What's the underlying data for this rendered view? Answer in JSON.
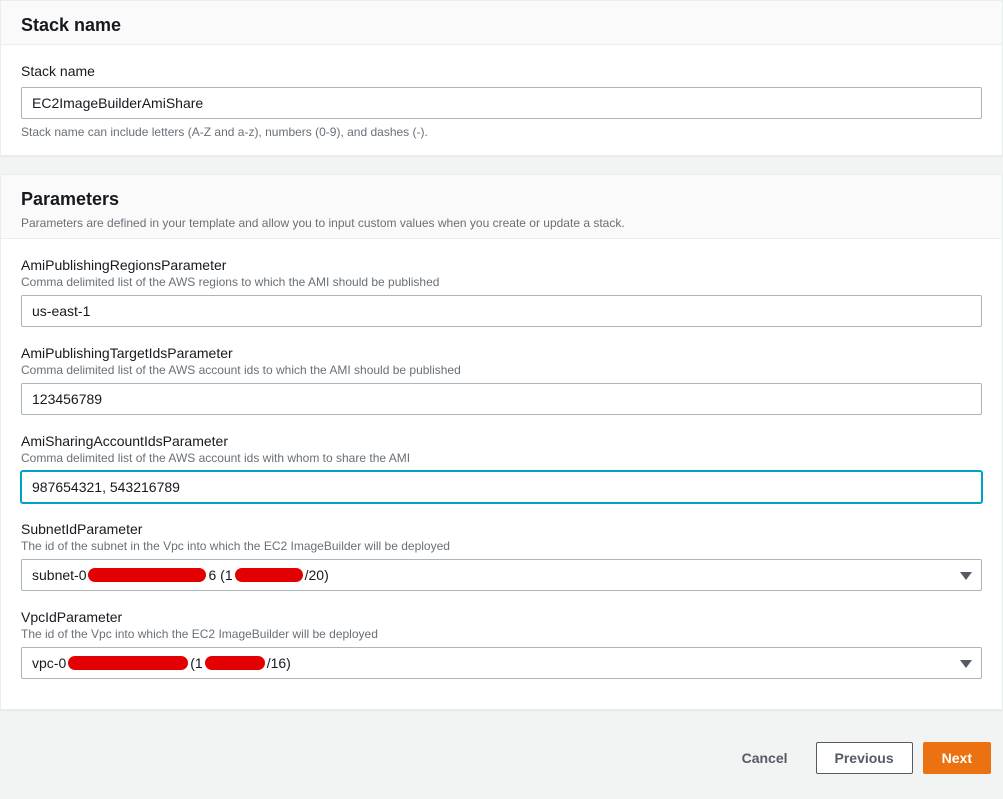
{
  "stack_name_section": {
    "title": "Stack name",
    "field_label": "Stack name",
    "value": "EC2ImageBuilderAmiShare",
    "hint": "Stack name can include letters (A-Z and a-z), numbers (0-9), and dashes (-)."
  },
  "parameters_section": {
    "title": "Parameters",
    "subtitle": "Parameters are defined in your template and allow you to input custom values when you create or update a stack.",
    "fields": [
      {
        "kind": "text",
        "label": "AmiPublishingRegionsParameter",
        "desc": "Comma delimited list of the AWS regions to which the AMI should be published",
        "value": "us-east-1",
        "focused": false
      },
      {
        "kind": "text",
        "label": "AmiPublishingTargetIdsParameter",
        "desc": "Comma delimited list of the AWS account ids to which the AMI should be published",
        "value": "123456789",
        "focused": false
      },
      {
        "kind": "text",
        "label": "AmiSharingAccountIdsParameter",
        "desc": "Comma delimited list of the AWS account ids with whom to share the AMI",
        "value": "987654321, 543216789",
        "focused": true
      },
      {
        "kind": "select",
        "label": "SubnetIdParameter",
        "desc": "The id of the subnet in the Vpc into which the EC2 ImageBuilder will be deployed",
        "display_parts": {
          "prefix": "subnet-0",
          "redact1_width": 118,
          "mid1": "6 (1",
          "redact2_width": 68,
          "suffix": "/20)"
        }
      },
      {
        "kind": "select",
        "label": "VpcIdParameter",
        "desc": "The id of the Vpc into which the EC2 ImageBuilder will be deployed",
        "display_parts": {
          "prefix": "vpc-0",
          "redact1_width": 120,
          "mid1": " (1",
          "redact2_width": 60,
          "suffix": "/16)"
        }
      }
    ]
  },
  "footer": {
    "cancel": "Cancel",
    "previous": "Previous",
    "next": "Next"
  }
}
